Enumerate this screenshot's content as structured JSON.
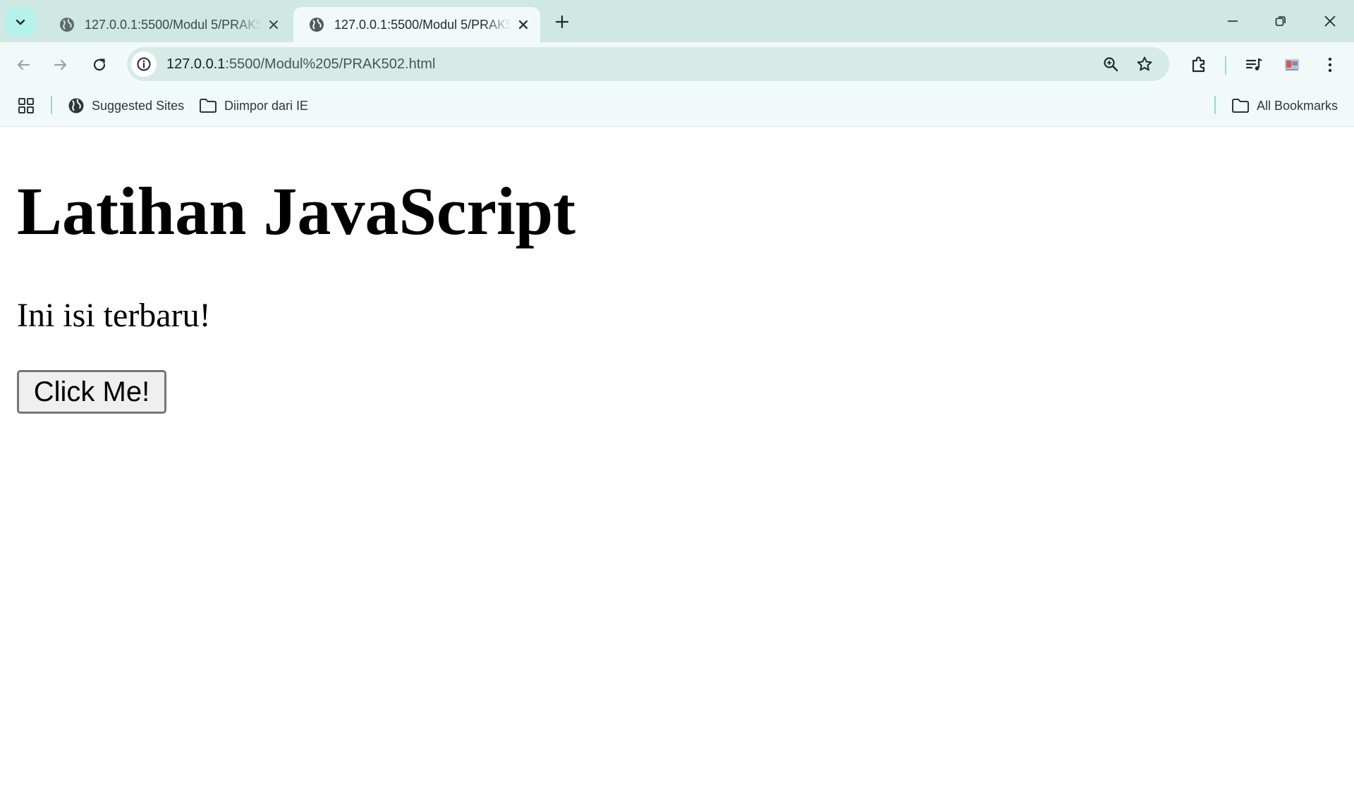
{
  "colors": {
    "tabstrip_bg": "#cfe8e4",
    "toolbar_bg": "#f2faf9",
    "omnibox_bg": "#d6ebe7",
    "separator": "#7fe3d6"
  },
  "tabs": [
    {
      "title": "127.0.0.1:5500/Modul 5/PRAK502.html",
      "favicon": "globe-icon",
      "active": false
    },
    {
      "title": "127.0.0.1:5500/Modul 5/PRAK502.html",
      "favicon": "globe-icon",
      "active": true
    }
  ],
  "address_bar": {
    "host": "127.0.0.1",
    "path": ":5500/Modul%205/PRAK502.html"
  },
  "bookmarks_bar": {
    "items": [
      {
        "label": "Suggested Sites",
        "icon": "globe-icon"
      },
      {
        "label": "Diimpor dari IE",
        "icon": "folder-icon"
      }
    ],
    "all_bookmarks_label": "All Bookmarks"
  },
  "page": {
    "heading": "Latihan JavaScript",
    "text": "Ini isi terbaru!",
    "button_label": "Click Me!"
  }
}
